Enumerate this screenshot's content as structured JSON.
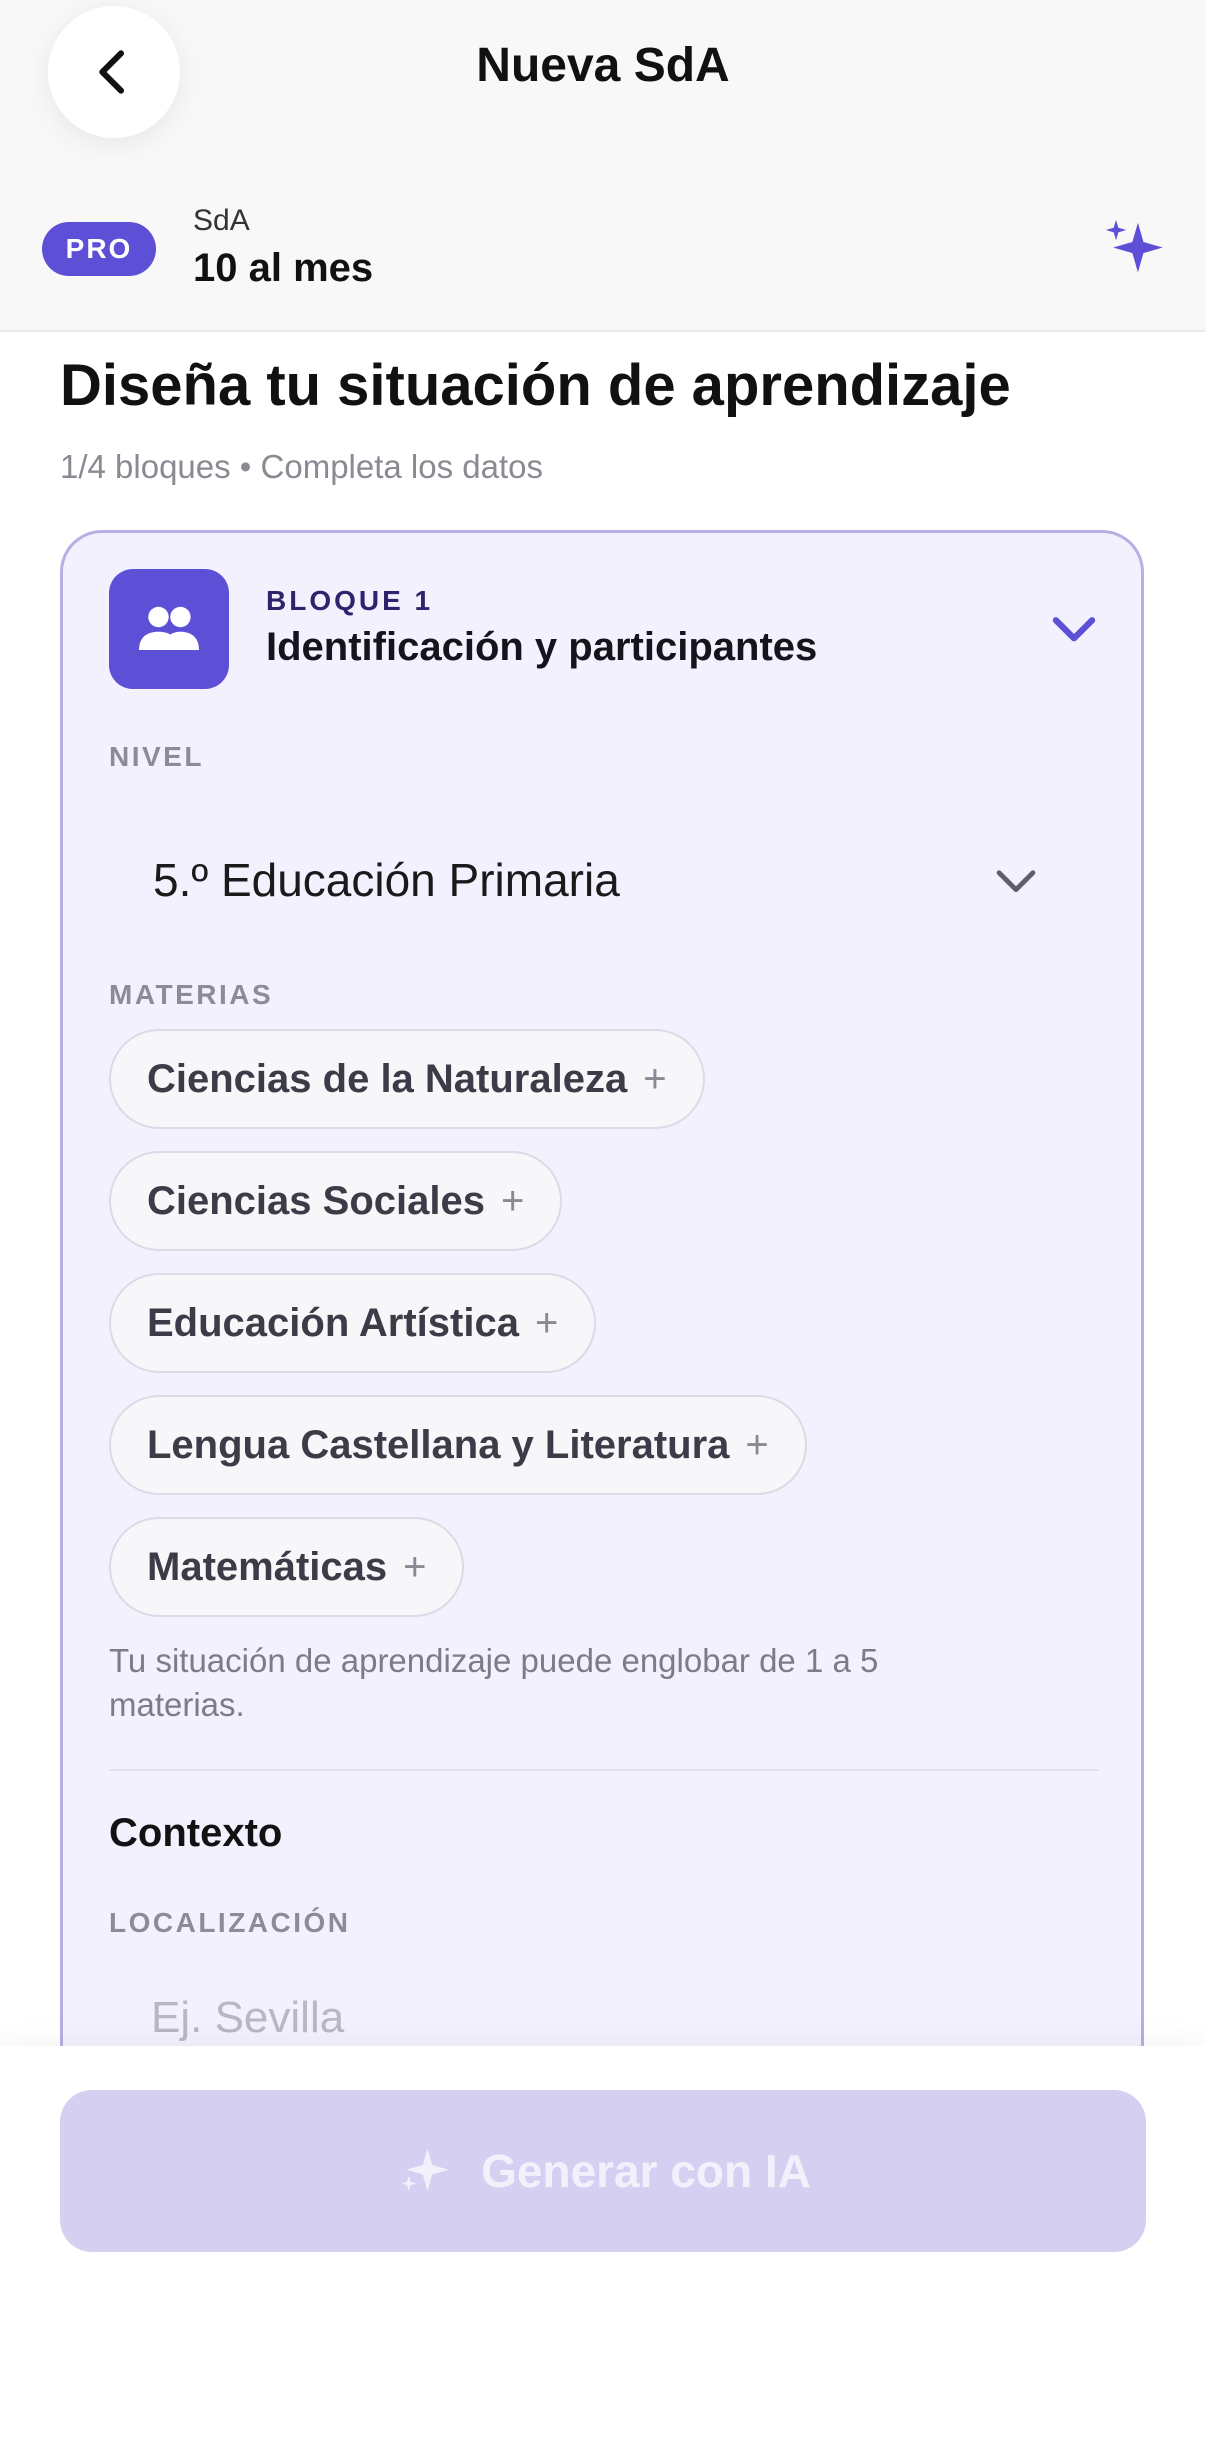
{
  "header": {
    "title": "Nueva SdA",
    "back_icon": "chevron-left-icon",
    "plan_badge": "PRO",
    "plan_label": "SdA",
    "plan_value": "10 al mes",
    "ai_icon": "sparkles-icon"
  },
  "page": {
    "title": "Diseña tu situación de aprendizaje",
    "subtitle": "1/4 bloques • Completa los datos"
  },
  "block": {
    "icon": "users-icon",
    "label": "BLOQUE 1",
    "title": "Identificación y participantes",
    "nivel": {
      "label": "NIVEL",
      "value": "5.º Educación Primaria"
    },
    "materias": {
      "label": "MATERIAS",
      "items": [
        {
          "label": "Ciencias de la Naturaleza",
          "action": "+"
        },
        {
          "label": "Ciencias Sociales",
          "action": "+"
        },
        {
          "label": "Educación Artística",
          "action": "+"
        },
        {
          "label": "Lengua Castellana y Literatura",
          "action": "+"
        },
        {
          "label": "Matemáticas",
          "action": "+"
        }
      ],
      "helper": "Tu situación de aprendizaje puede englobar de 1 a 5 materias."
    },
    "contexto": {
      "title": "Contexto",
      "localizacion_label": "LOCALIZACIÓN",
      "localizacion_value": "",
      "localizacion_placeholder": "Ej. Sevilla"
    }
  },
  "footer": {
    "generate_label": "Generar con IA",
    "generate_icon": "sparkles-icon",
    "generate_enabled": false
  },
  "colors": {
    "accent": "#5d4fd6",
    "card_bg": "#f3f1fd",
    "card_border": "#b6b0e3",
    "button_disabled": "#d5d0f2"
  }
}
